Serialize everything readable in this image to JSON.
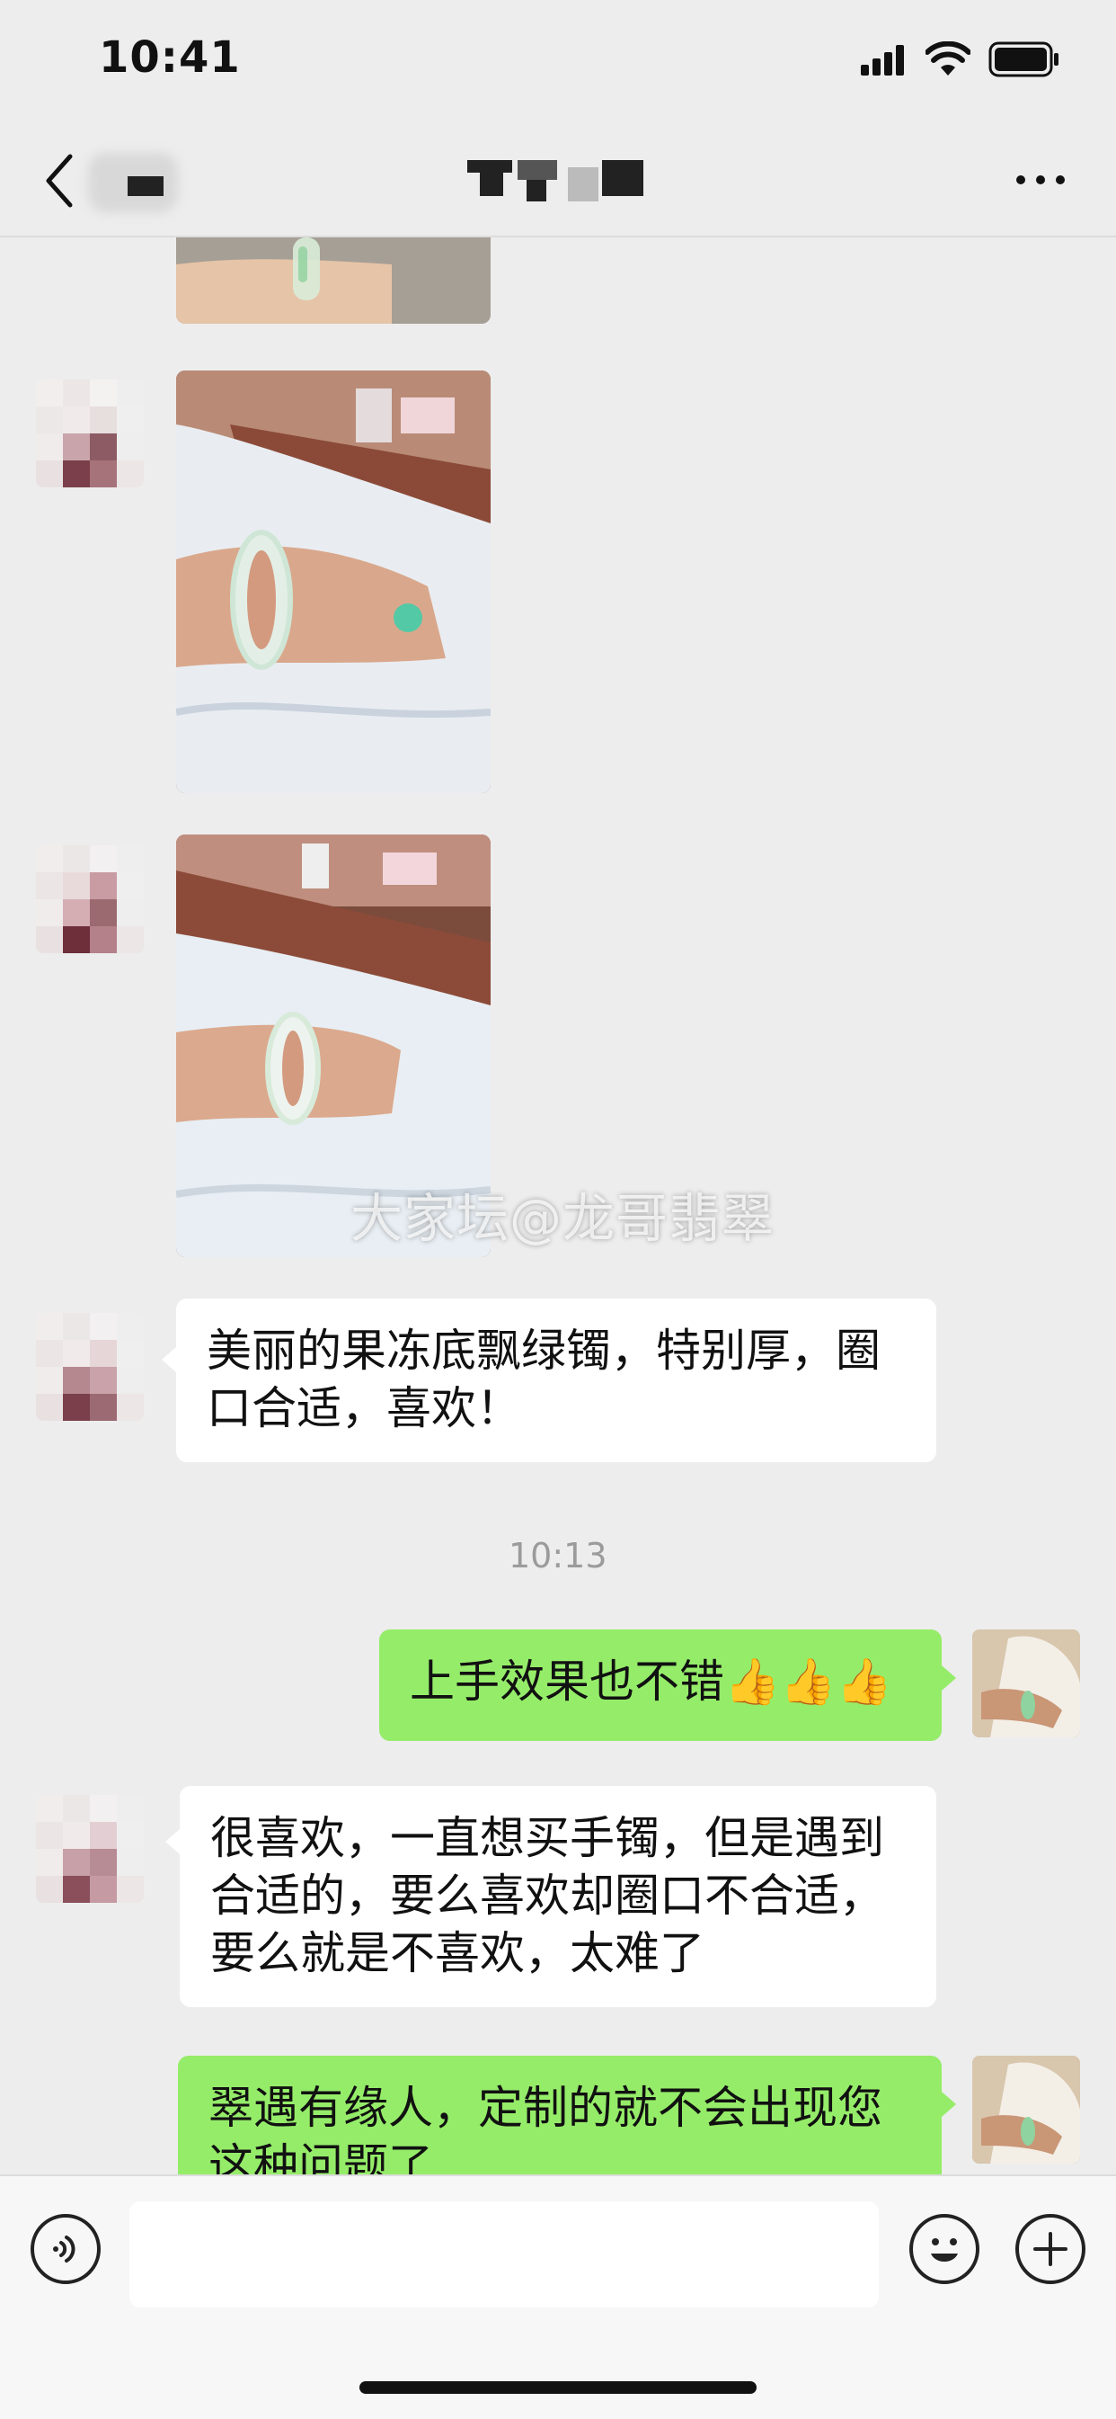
{
  "status_bar": {
    "time": "10:41"
  },
  "chat": {
    "messages": [
      {
        "text": "美丽的果冻底飘绿镯，特别厚，圈口合适，喜欢！"
      },
      {
        "text": "上手效果也不错👍👍👍"
      },
      {
        "text": "很喜欢，一直想买手镯，但是遇到合适的，要么喜欢却圈口不合适，要么就是不喜欢，太难了"
      },
      {
        "text": "翠遇有缘人，定制的就不会出现您这种问题了"
      }
    ],
    "timestamp": "10:13",
    "watermark": "大家坛@龙哥翡翠"
  },
  "colors": {
    "background": "#ededed",
    "outgoing_bubble": "#95ec69",
    "incoming_bubble": "#ffffff"
  },
  "icons": [
    "back-chevron-icon",
    "more-icon",
    "voice-icon",
    "emoji-icon",
    "plus-icon",
    "signal-icon",
    "wifi-icon",
    "battery-icon"
  ]
}
